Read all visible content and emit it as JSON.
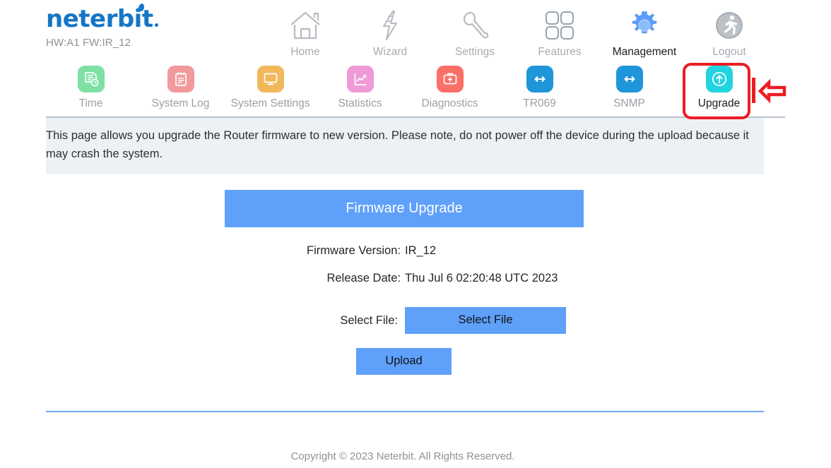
{
  "brand": {
    "logo_text": "neterbit",
    "device_info": "HW:A1 FW:IR_12"
  },
  "top_nav": {
    "items": [
      {
        "label": "Home",
        "icon": "house-icon",
        "active": false
      },
      {
        "label": "Wizard",
        "icon": "lightning-bolt-icon",
        "active": false
      },
      {
        "label": "Settings",
        "icon": "wrench-icon",
        "active": false
      },
      {
        "label": "Features",
        "icon": "grid-squares-icon",
        "active": false
      },
      {
        "label": "Management",
        "icon": "gear-icon",
        "active": true
      },
      {
        "label": "Logout",
        "icon": "running-person-icon",
        "active": false
      }
    ]
  },
  "sub_nav": {
    "items": [
      {
        "label": "Time",
        "icon": "document-clock-icon",
        "color": "#7ee0a2",
        "active": false
      },
      {
        "label": "System Log",
        "icon": "clipboard-icon",
        "color": "#f2999c",
        "active": false
      },
      {
        "label": "System Settings",
        "icon": "monitor-icon",
        "color": "#f2b85c",
        "active": false
      },
      {
        "label": "Statistics",
        "icon": "line-chart-icon",
        "color": "#ef9ad6",
        "active": false
      },
      {
        "label": "Diagnostics",
        "icon": "medical-kit-icon",
        "color": "#fb6f68",
        "active": false
      },
      {
        "label": "TR069",
        "icon": "double-arrow-icon",
        "color": "#1f95da",
        "active": false
      },
      {
        "label": "SNMP",
        "icon": "double-arrow-icon",
        "color": "#1f95da",
        "active": false
      },
      {
        "label": "Upgrade",
        "icon": "arrow-up-circle-icon",
        "color": "#22d3e0",
        "active": true
      }
    ]
  },
  "annotation": {
    "highlight_target": "Upgrade",
    "box_color": "#ec1c24",
    "arrow_icon": "left-arrow-annotation-icon"
  },
  "notice": {
    "text": "This page allows you upgrade the Router firmware to new version. Please note, do not power off the device during the upload because it may crash the system."
  },
  "main": {
    "section_title": "Firmware Upgrade",
    "firmware_version_label": "Firmware Version:",
    "firmware_version_value": "IR_12",
    "release_date_label": "Release Date:",
    "release_date_value": "Thu Jul 6 02:20:48 UTC 2023",
    "select_file_label": "Select File:",
    "select_file_button": "Select File",
    "upload_button": "Upload"
  },
  "footer": {
    "copyright": "Copyright © 2023 Neterbit. All Rights Reserved."
  },
  "colors": {
    "accent_blue": "#5fa0fb",
    "notice_bg": "#edf1f4",
    "annotation_red": "#ec1c24",
    "brand_blue": "#1576C6"
  }
}
